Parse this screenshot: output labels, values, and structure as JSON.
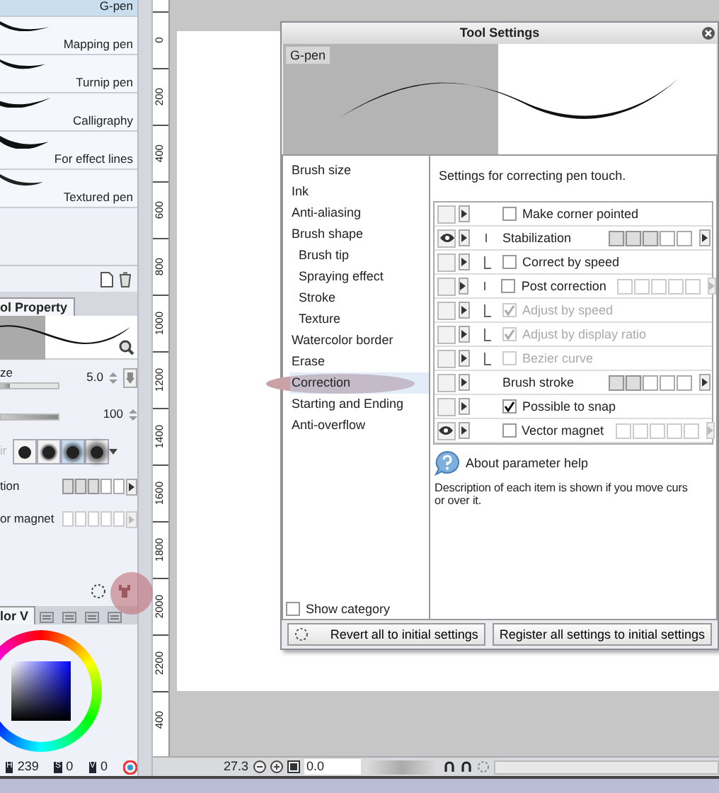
{
  "brush_list": {
    "items": [
      {
        "label": "G-pen",
        "selected": true
      },
      {
        "label": "Mapping pen",
        "selected": false
      },
      {
        "label": "Turnip pen",
        "selected": false
      },
      {
        "label": "Calligraphy",
        "selected": false
      },
      {
        "label": "For effect lines",
        "selected": false
      },
      {
        "label": "Textured pen",
        "selected": false
      }
    ]
  },
  "tool_property": {
    "tab": "ol Property",
    "rows": [
      {
        "kind": "slider",
        "label": "ze",
        "value": "5.0",
        "level": 0.15
      },
      {
        "kind": "slider",
        "value": "100",
        "level": 1
      },
      {
        "kind": "tips",
        "label": "ir",
        "tips": [
          {
            "kind": "hard",
            "selected": false
          },
          {
            "kind": "medium",
            "selected": false
          },
          {
            "kind": "soft",
            "selected": true
          },
          {
            "kind": "airbrush",
            "selected": false
          }
        ]
      },
      {
        "kind": "steps",
        "label": "tion",
        "level": 0.6,
        "disabled": false
      },
      {
        "kind": "steps",
        "label": "or magnet",
        "disabled": true
      }
    ]
  },
  "color_panel": {
    "tab": "lor V",
    "hsv": [
      {
        "letter": "H",
        "value": "239"
      },
      {
        "letter": "S",
        "value": "0"
      },
      {
        "letter": "V",
        "value": "0"
      }
    ]
  },
  "ruler": {
    "labels": [
      "0",
      "200",
      "400",
      "600",
      "800",
      "1000",
      "1200",
      "1400",
      "1600",
      "1800",
      "2000",
      "2200",
      "400"
    ]
  },
  "status_bar": {
    "zoom": "27.3",
    "angle": "0.0"
  },
  "tool_settings": {
    "title": "Tool Settings",
    "preview_label": "G-pen",
    "categories": [
      {
        "label": "Brush size",
        "selected": false
      },
      {
        "label": "Ink",
        "selected": false
      },
      {
        "label": "Anti-aliasing",
        "selected": false
      },
      {
        "label": "Brush shape",
        "selected": false,
        "children": [
          {
            "label": "Brush tip",
            "selected": false
          },
          {
            "label": "Spraying effect",
            "selected": false
          },
          {
            "label": "Stroke",
            "selected": false
          },
          {
            "label": "Texture",
            "selected": false
          }
        ]
      },
      {
        "label": "Watercolor border",
        "selected": false
      },
      {
        "label": "Erase",
        "selected": false
      },
      {
        "label": "Correction",
        "selected": true
      },
      {
        "label": "Starting and Ending",
        "selected": false
      },
      {
        "label": "Anti-overflow",
        "selected": false
      }
    ],
    "show_category": {
      "label": "Show category",
      "checked": false
    },
    "description": "Settings for correcting pen touch.",
    "settings": [
      {
        "kind": "checkbox",
        "label": "Make corner pointed",
        "checked": false,
        "disabled": false,
        "eye": false
      },
      {
        "kind": "steps",
        "label": "Stabilization",
        "level": 0.6,
        "disabled": false,
        "eye": true,
        "children": [
          {
            "kind": "checkbox",
            "label": "Correct by speed",
            "checked": false,
            "disabled": false,
            "eye": false
          }
        ]
      },
      {
        "kind": "checkbox_steps",
        "label": "Post correction",
        "checked": false,
        "disabled": true,
        "eye": false,
        "children": [
          {
            "kind": "checkbox",
            "label": "Adjust by speed",
            "checked": true,
            "disabled": true,
            "eye": false
          },
          {
            "kind": "checkbox",
            "label": "Adjust by display ratio",
            "checked": true,
            "disabled": true,
            "eye": false
          },
          {
            "kind": "checkbox",
            "label": "Bezier curve",
            "checked": false,
            "disabled": true,
            "eye": false
          }
        ]
      },
      {
        "kind": "steps",
        "label": "Brush stroke",
        "level": 0.4,
        "disabled": false,
        "eye": false
      },
      {
        "kind": "checkbox",
        "label": "Possible to snap",
        "checked": true,
        "disabled": false,
        "eye": false
      },
      {
        "kind": "checkbox_steps",
        "label": "Vector magnet",
        "checked": false,
        "disabled": true,
        "eye": true
      }
    ],
    "help": {
      "title": "About parameter help",
      "lines": [
        "Description of each item is shown if you move curs",
        "or over it."
      ]
    },
    "buttons": [
      "Revert all to initial settings",
      "Register all settings to initial settings"
    ]
  }
}
